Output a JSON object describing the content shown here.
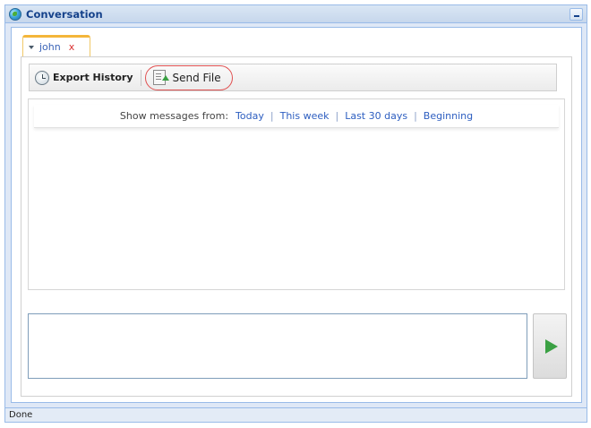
{
  "window": {
    "title": "Conversation"
  },
  "tab": {
    "label": "john",
    "close": "x"
  },
  "toolbar": {
    "export_label": "Export History",
    "send_file_label": "Send File"
  },
  "filter": {
    "label": "Show messages from:",
    "links": [
      "Today",
      "This week",
      "Last 30 days",
      "Beginning"
    ],
    "separator": "|"
  },
  "compose": {
    "value": ""
  },
  "status": {
    "text": "Done"
  },
  "colors": {
    "accent": "#2d5ec0",
    "tab_highlight": "#f4b63a",
    "send_highlight": "#e05050",
    "send_arrow": "#3aa043"
  },
  "icons": {
    "title": "globe-icon",
    "export": "export-history-icon",
    "send_file": "send-file-icon",
    "send": "send-arrow-icon"
  }
}
